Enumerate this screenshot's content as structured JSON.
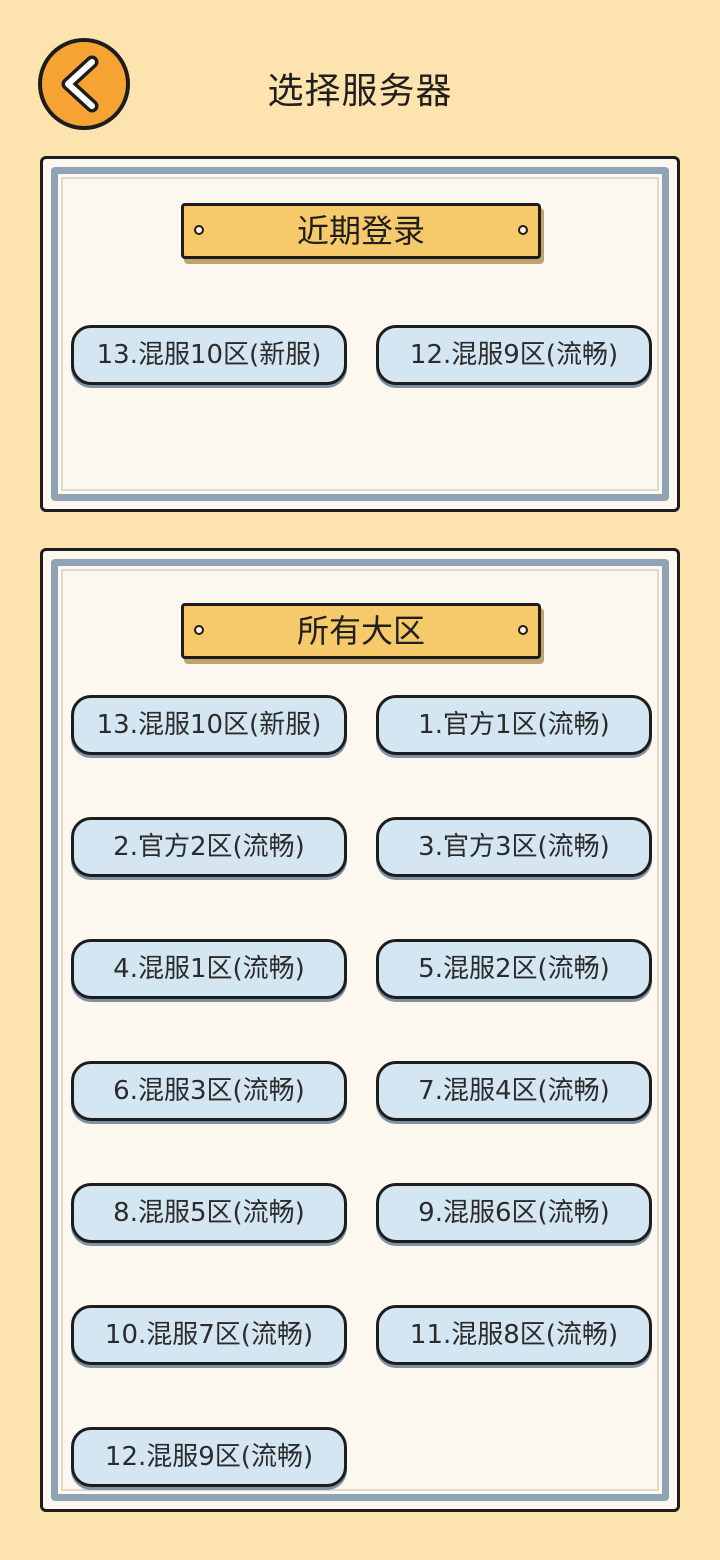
{
  "header": {
    "title": "选择服务器",
    "back_icon": "chevron-left-icon",
    "accent_color": "#f7a334"
  },
  "recent": {
    "title": "近期登录",
    "servers": [
      "13.混服10区(新服)",
      "12.混服9区(流畅)"
    ]
  },
  "all": {
    "title": "所有大区",
    "servers": [
      "13.混服10区(新服)",
      "1.官方1区(流畅)",
      "2.官方2区(流畅)",
      "3.官方3区(流畅)",
      "4.混服1区(流畅)",
      "5.混服2区(流畅)",
      "6.混服3区(流畅)",
      "7.混服4区(流畅)",
      "8.混服5区(流畅)",
      "9.混服6区(流畅)",
      "10.混服7区(流畅)",
      "11.混服8区(流畅)",
      "12.混服9区(流畅)"
    ]
  }
}
